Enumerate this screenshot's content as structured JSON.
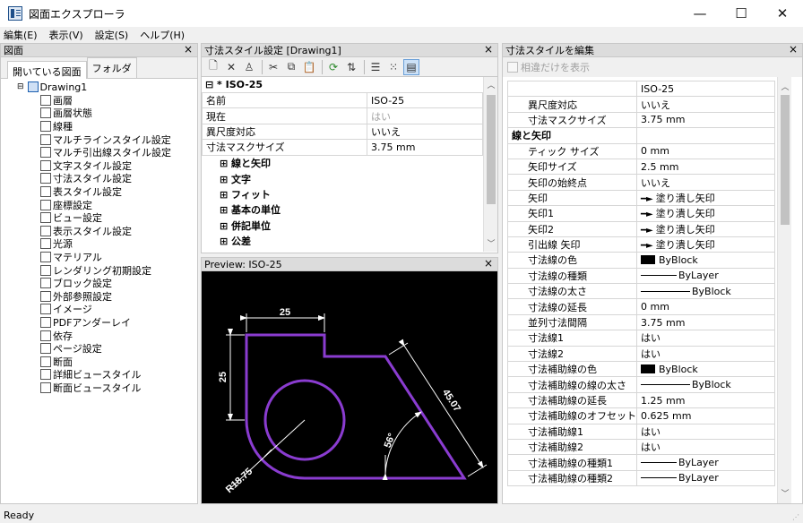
{
  "app": {
    "title": "図面エクスプローラ",
    "minimize": "—",
    "maximize": "☐",
    "close": "✕"
  },
  "menu": [
    "編集(E)",
    "表示(V)",
    "設定(S)",
    "ヘルプ(H)"
  ],
  "left_panel": {
    "title": "図面",
    "close": "×",
    "tabs": [
      "開いている図面",
      "フォルダ"
    ],
    "root": "Drawing1",
    "items": [
      {
        "label": "画層",
        "icon": "layer-icon"
      },
      {
        "label": "画層状態",
        "icon": "layer-state-icon"
      },
      {
        "label": "線種",
        "icon": "linetype-icon"
      },
      {
        "label": "マルチラインスタイル設定",
        "icon": "multiline-style-icon"
      },
      {
        "label": "マルチ引出線スタイル設定",
        "icon": "multileader-style-icon"
      },
      {
        "label": "文字スタイル設定",
        "icon": "text-style-icon"
      },
      {
        "label": "寸法スタイル設定",
        "icon": "dim-style-icon"
      },
      {
        "label": "表スタイル設定",
        "icon": "table-style-icon"
      },
      {
        "label": "座標設定",
        "icon": "ucs-icon"
      },
      {
        "label": "ビュー設定",
        "icon": "view-icon"
      },
      {
        "label": "表示スタイル設定",
        "icon": "visual-style-icon"
      },
      {
        "label": "光源",
        "icon": "light-icon"
      },
      {
        "label": "マテリアル",
        "icon": "material-icon"
      },
      {
        "label": "レンダリング初期設定",
        "icon": "render-preset-icon"
      },
      {
        "label": "ブロック設定",
        "icon": "block-icon"
      },
      {
        "label": "外部参照設定",
        "icon": "xref-icon"
      },
      {
        "label": "イメージ",
        "icon": "image-icon"
      },
      {
        "label": "PDFアンダーレイ",
        "icon": "pdf-icon"
      },
      {
        "label": "依存",
        "icon": "dependency-icon"
      },
      {
        "label": "ページ設定",
        "icon": "page-setup-icon"
      },
      {
        "label": "断面",
        "icon": "section-icon"
      },
      {
        "label": "詳細ビュースタイル",
        "icon": "detail-view-icon"
      },
      {
        "label": "断面ビュースタイル",
        "icon": "section-view-icon"
      }
    ]
  },
  "mid_panel": {
    "title": "寸法スタイル設定 [Drawing1]",
    "close": "×",
    "toolbar": [
      "new-icon",
      "delete-icon",
      "purge-icon",
      "cut-icon",
      "copy-icon",
      "paste-icon",
      "refresh-icon",
      "swap-icon",
      "list-view-icon",
      "icon-view-icon",
      "preview-view-icon"
    ],
    "style_header": "⊟ * ISO-25",
    "rows": [
      {
        "k": "名前",
        "v": "ISO-25"
      },
      {
        "k": "現在",
        "v": "はい",
        "dim": true
      },
      {
        "k": "異尺度対応",
        "v": "いいえ"
      },
      {
        "k": "寸法マスクサイズ",
        "v": "3.75 mm"
      }
    ],
    "groups": [
      "⊞ 線と矢印",
      "⊞ 文字",
      "⊞ フィット",
      "⊞ 基本の単位",
      "⊞ 併記単位",
      "⊞ 公差"
    ]
  },
  "preview_panel": {
    "title": "Preview: ISO-25",
    "close": "×",
    "labels": {
      "top": "25",
      "left": "25",
      "diag": "45.07",
      "angle": "56°",
      "radius": "R18.75"
    },
    "colors": {
      "bg": "#000000",
      "shape": "#8a3cd0",
      "dim": "#ffffff"
    }
  },
  "right_panel": {
    "title": "寸法スタイルを編集",
    "close": "×",
    "checkbox_label": "相違だけを表示",
    "rows": [
      {
        "k": "",
        "v": "ISO-25",
        "type": "plain"
      },
      {
        "k": "異尺度対応",
        "v": "いいえ",
        "type": "plain"
      },
      {
        "k": "寸法マスクサイズ",
        "v": "3.75 mm",
        "type": "plain"
      },
      {
        "k": "線と矢印",
        "v": "",
        "type": "section"
      },
      {
        "k": "ティック サイズ",
        "v": "0 mm",
        "type": "plain"
      },
      {
        "k": "矢印サイズ",
        "v": "2.5 mm",
        "type": "plain"
      },
      {
        "k": "矢印の始終点",
        "v": "いいえ",
        "type": "plain"
      },
      {
        "k": "矢印",
        "v": "塗り潰し矢印",
        "type": "arrow"
      },
      {
        "k": "矢印1",
        "v": "塗り潰し矢印",
        "type": "arrow"
      },
      {
        "k": "矢印2",
        "v": "塗り潰し矢印",
        "type": "arrow"
      },
      {
        "k": "引出線 矢印",
        "v": "塗り潰し矢印",
        "type": "arrow"
      },
      {
        "k": "寸法線の色",
        "v": "ByBlock",
        "type": "color"
      },
      {
        "k": "寸法線の種類",
        "v": "ByLayer",
        "type": "line"
      },
      {
        "k": "寸法線の太さ",
        "v": "ByBlock",
        "type": "lline"
      },
      {
        "k": "寸法線の延長",
        "v": "0 mm",
        "type": "plain"
      },
      {
        "k": "並列寸法間隔",
        "v": "3.75 mm",
        "type": "plain"
      },
      {
        "k": "寸法線1",
        "v": "はい",
        "type": "plain"
      },
      {
        "k": "寸法線2",
        "v": "はい",
        "type": "plain"
      },
      {
        "k": "寸法補助線の色",
        "v": "ByBlock",
        "type": "color"
      },
      {
        "k": "寸法補助線の線の太さ",
        "v": "ByBlock",
        "type": "lline"
      },
      {
        "k": "寸法補助線の延長",
        "v": "1.25 mm",
        "type": "plain"
      },
      {
        "k": "寸法補助線のオフセット",
        "v": "0.625 mm",
        "type": "plain"
      },
      {
        "k": "寸法補助線1",
        "v": "はい",
        "type": "plain"
      },
      {
        "k": "寸法補助線2",
        "v": "はい",
        "type": "plain"
      },
      {
        "k": "寸法補助線の種類1",
        "v": "ByLayer",
        "type": "line"
      },
      {
        "k": "寸法補助線の種類2",
        "v": "ByLayer",
        "type": "line"
      }
    ]
  },
  "status": {
    "text": "Ready"
  }
}
